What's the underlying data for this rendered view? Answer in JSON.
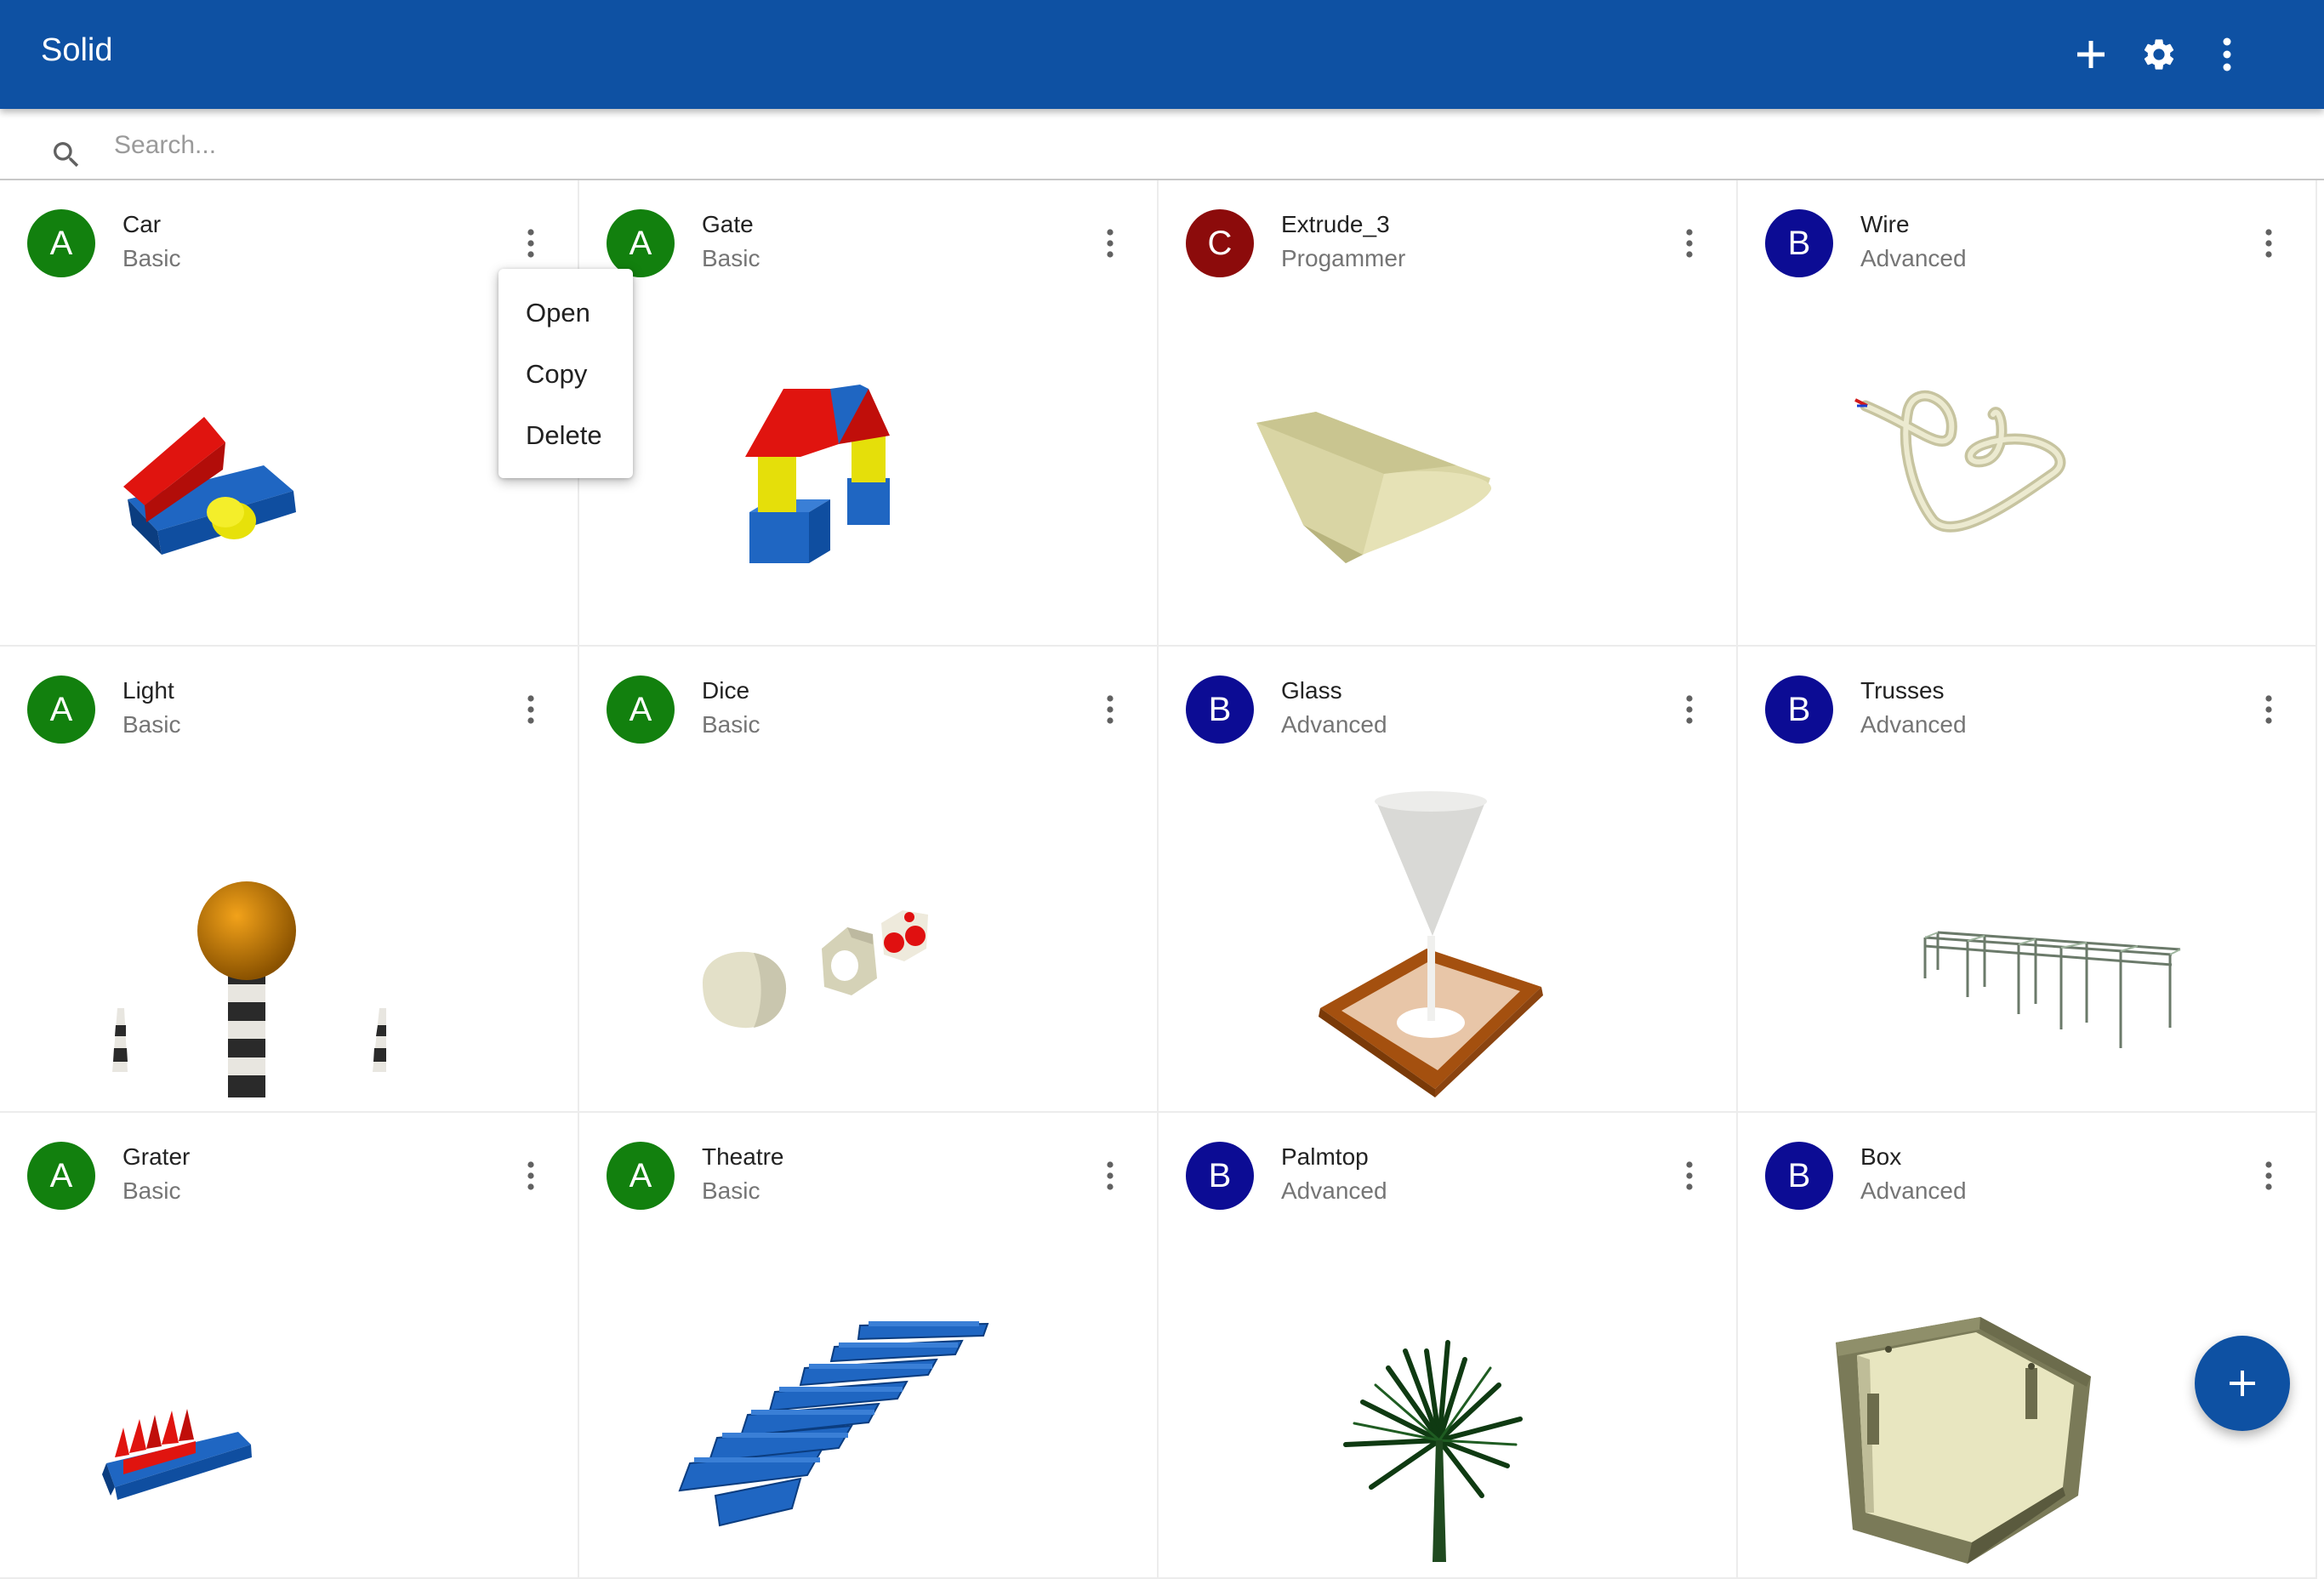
{
  "app": {
    "title": "Solid"
  },
  "toolbar": {
    "add_icon": "plus-icon",
    "settings_icon": "gear-icon",
    "more_icon": "more-vert-icon"
  },
  "search": {
    "placeholder": "Search..."
  },
  "colors": {
    "primary": "#0e51a3",
    "avatar_a": "#12800e",
    "avatar_b": "#0c0c94",
    "avatar_c": "#8c0b0b"
  },
  "cards": [
    {
      "initial": "A",
      "name": "Car",
      "category": "Basic"
    },
    {
      "initial": "A",
      "name": "Gate",
      "category": "Basic"
    },
    {
      "initial": "C",
      "name": "Extrude_3",
      "category": "Progammer"
    },
    {
      "initial": "B",
      "name": "Wire",
      "category": "Advanced"
    },
    {
      "initial": "A",
      "name": "Light",
      "category": "Basic"
    },
    {
      "initial": "A",
      "name": "Dice",
      "category": "Basic"
    },
    {
      "initial": "B",
      "name": "Glass",
      "category": "Advanced"
    },
    {
      "initial": "B",
      "name": "Trusses",
      "category": "Advanced"
    },
    {
      "initial": "A",
      "name": "Grater",
      "category": "Basic"
    },
    {
      "initial": "A",
      "name": "Theatre",
      "category": "Basic"
    },
    {
      "initial": "B",
      "name": "Palmtop",
      "category": "Advanced"
    },
    {
      "initial": "B",
      "name": "Box",
      "category": "Advanced"
    }
  ],
  "context_menu": {
    "items": [
      "Open",
      "Copy",
      "Delete"
    ]
  },
  "fab": {
    "icon": "plus-icon"
  }
}
